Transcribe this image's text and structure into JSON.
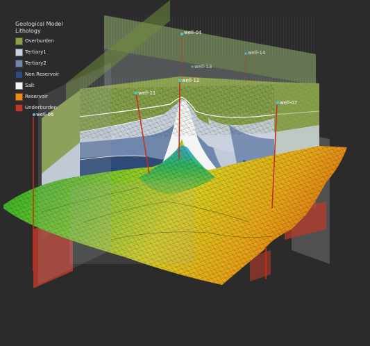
{
  "legend": {
    "title_line1": "Geological Model",
    "title_line2": "Lithology",
    "items": [
      {
        "label": "Overburden",
        "color": "#8aa04e"
      },
      {
        "label": "Tertiary1",
        "color": "#c9d1de"
      },
      {
        "label": "Tertiary2",
        "color": "#6f87ad"
      },
      {
        "label": "Non Reservoir",
        "color": "#2e4a78"
      },
      {
        "label": "Salt",
        "color": "#f4f4f4"
      },
      {
        "label": "Reservoir",
        "color": "#f08a1c"
      },
      {
        "label": "Underburden",
        "color": "#b83a2a"
      }
    ]
  },
  "wells": {
    "w04": "well-04",
    "w14": "well-14",
    "w13": "well-13",
    "w11": "well-11",
    "w12": "well-12",
    "w07": "well-07",
    "w06": "well-06"
  },
  "colors": {
    "background": "#2b2b2b",
    "well_trajectory": "#c8301e",
    "well_marker": "#49c6e0"
  }
}
